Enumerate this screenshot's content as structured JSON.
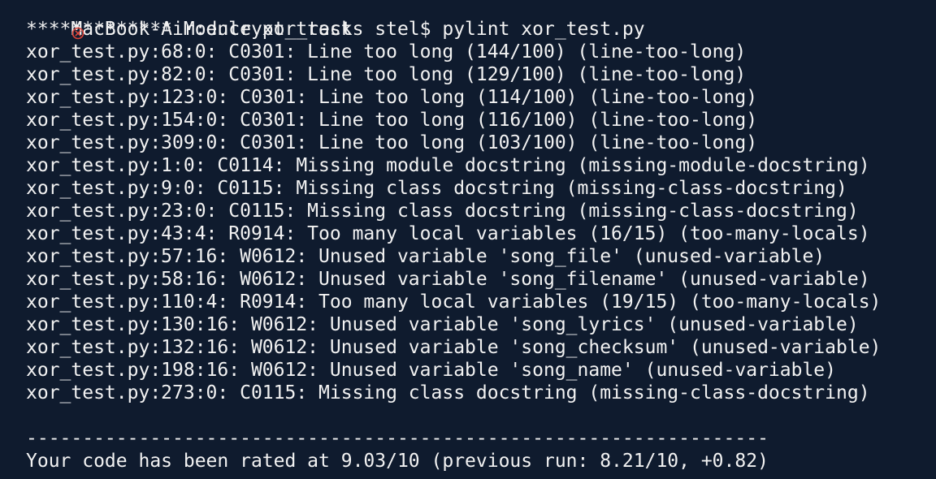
{
  "terminal": {
    "prompt_command": "MacBook-Air:encrypt_tracks stel$ pylint xor_test.py",
    "module_header": "************* Module xor_test",
    "messages": [
      "xor_test.py:68:0: C0301: Line too long (144/100) (line-too-long)",
      "xor_test.py:82:0: C0301: Line too long (129/100) (line-too-long)",
      "xor_test.py:123:0: C0301: Line too long (114/100) (line-too-long)",
      "xor_test.py:154:0: C0301: Line too long (116/100) (line-too-long)",
      "xor_test.py:309:0: C0301: Line too long (103/100) (line-too-long)",
      "xor_test.py:1:0: C0114: Missing module docstring (missing-module-docstring)",
      "xor_test.py:9:0: C0115: Missing class docstring (missing-class-docstring)",
      "xor_test.py:23:0: C0115: Missing class docstring (missing-class-docstring)",
      "xor_test.py:43:4: R0914: Too many local variables (16/15) (too-many-locals)",
      "xor_test.py:57:16: W0612: Unused variable 'song_file' (unused-variable)",
      "xor_test.py:58:16: W0612: Unused variable 'song_filename' (unused-variable)",
      "xor_test.py:110:4: R0914: Too many local variables (19/15) (too-many-locals)",
      "xor_test.py:130:16: W0612: Unused variable 'song_lyrics' (unused-variable)",
      "xor_test.py:132:16: W0612: Unused variable 'song_checksum' (unused-variable)",
      "xor_test.py:198:16: W0612: Unused variable 'song_name' (unused-variable)",
      "xor_test.py:273:0: C0115: Missing class docstring (missing-class-docstring)"
    ],
    "separator": "------------------------------------------------------------------",
    "rating": "Your code has been rated at 9.03/10 (previous run: 8.21/10, +0.82)",
    "colors": {
      "background": "#0f1b2e",
      "text": "#f2f2f2",
      "error_icon": "#e0453a"
    },
    "icons": {
      "status": "error-circle-icon"
    }
  }
}
